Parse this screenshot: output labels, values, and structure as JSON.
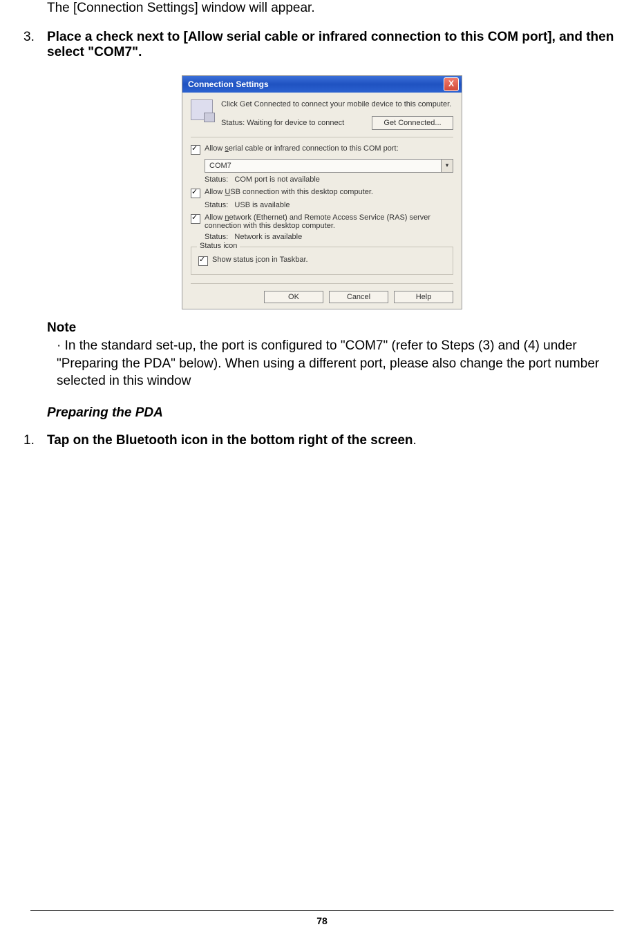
{
  "intro_line": "The [Connection Settings] window will appear.",
  "step3": {
    "num": "3.",
    "text": "Place a check next to [Allow serial cable or infrared connection to this COM port], and then select \"COM7\"."
  },
  "dialog": {
    "title": "Connection Settings",
    "close_glyph": "X",
    "top_message": "Click Get Connected to connect your mobile device to this computer.",
    "status_label": "Status: Waiting for device to connect",
    "get_connected_btn": "Get Connected...",
    "cb_serial_pre": "Allow ",
    "cb_serial_u": "s",
    "cb_serial_post": "erial cable or infrared connection to this COM port:",
    "combo_value": "COM7",
    "combo_arrow": "▾",
    "serial_status_label": "Status:",
    "serial_status_value": "COM port is not available",
    "cb_usb_pre": "Allow ",
    "cb_usb_u": "U",
    "cb_usb_post": "SB connection with this desktop computer.",
    "usb_status_label": "Status:",
    "usb_status_value": "USB is available",
    "cb_net_pre": "Allow ",
    "cb_net_u": "n",
    "cb_net_post": "etwork (Ethernet) and Remote Access Service (RAS) server connection with this desktop computer.",
    "net_status_label": "Status:",
    "net_status_value": "Network is available",
    "fieldset_legend": "Status icon",
    "cb_tray_pre": "Show status ",
    "cb_tray_u": "i",
    "cb_tray_post": "con in Taskbar.",
    "ok_btn": "OK",
    "cancel_btn": "Cancel",
    "help_btn": "Help"
  },
  "note": {
    "heading": "Note",
    "bullet": "· ",
    "text": "In the standard set-up, the port is configured to \"COM7\" (refer to Steps (3) and (4) under \"Preparing the PDA\" below). When using a different port, please also change the port number selected in this window"
  },
  "section_preparing": "Preparing the PDA",
  "step1": {
    "num": "1.",
    "text_bold": "Tap on the Bluetooth icon in the bottom right of the screen",
    "text_tail": "."
  },
  "page_number": "78"
}
